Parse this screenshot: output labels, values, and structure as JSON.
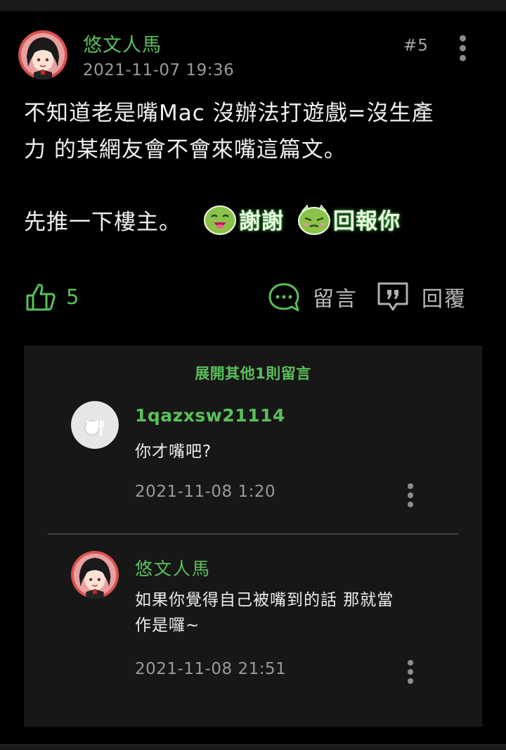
{
  "post": {
    "author": "悠文人馬",
    "timestamp": "2021-11-07 19:36",
    "floor": "#5",
    "body_line1": "不知道老是嘴Mac 沒辦法打遊戲=沒生產",
    "body_line2": "力 的某網友會不會來嘴這篇文。",
    "body_line4": "先推一下樓主。",
    "sticker1_text": "謝謝",
    "sticker2_text": "回報你",
    "like_count": "5",
    "comment_label": "留言",
    "reply_label": "回覆"
  },
  "replies": {
    "expand_label": "展開其他1則留言",
    "items": [
      {
        "author": "1qazxsw21114",
        "text": "你才嘴吧?",
        "timestamp": "2021-11-08 1:20"
      },
      {
        "author": "悠文人馬",
        "text_line1": "如果你覺得自己被嘴到的話 那就當",
        "text_line2": "作是囉~",
        "timestamp": "2021-11-08 21:51"
      }
    ]
  },
  "colors": {
    "accent_green": "#5bbf5b",
    "background": "#000000",
    "replies_panel": "#171717"
  },
  "icons": {
    "like": "thumbs-up-icon",
    "comment": "speech-bubble-icon",
    "reply": "quote-reply-icon",
    "more": "kebab-menu-icon"
  }
}
